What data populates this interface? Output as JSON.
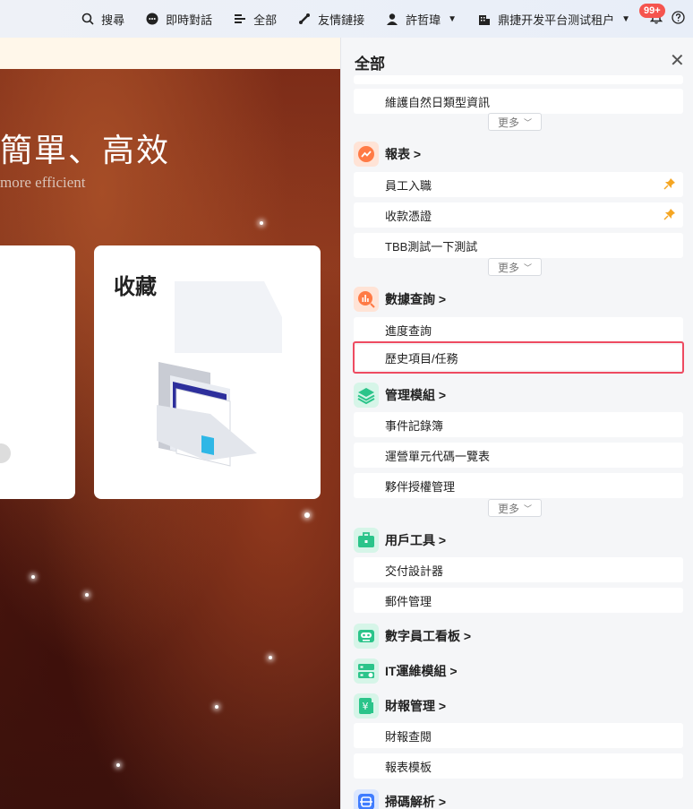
{
  "topbar": {
    "search_label": "搜尋",
    "chat_label": "即時對話",
    "all_label": "全部",
    "links_label": "友情鏈接",
    "user_label": "許哲瑋",
    "tenant_label": "鼎捷开发平台测试租户",
    "notification_count": "99+"
  },
  "hero": {
    "title": "簡單、高效",
    "subtitle": "more efficient",
    "fav_card_title": "收藏"
  },
  "panel": {
    "title": "全部",
    "more_label": "更多",
    "top_item": "維護自然日類型資訊",
    "groups": [
      {
        "label": "報表 >",
        "items": [
          "員工入職",
          "收款憑證",
          "TBB測試一下測試"
        ]
      },
      {
        "label": "數據查詢 >",
        "items": [
          "進度查詢",
          "歷史項目/任務"
        ]
      },
      {
        "label": "管理模組 >",
        "items": [
          "事件記錄簿",
          "運營單元代碼一覽表",
          "夥伴授權管理"
        ]
      },
      {
        "label": "用戶工具 >",
        "items": [
          "交付設計器",
          "郵件管理"
        ]
      },
      {
        "label": "數字員工看板 >",
        "items": []
      },
      {
        "label": "IT運維模組 >",
        "items": []
      },
      {
        "label": "財報管理 >",
        "items": [
          "財報查閱",
          "報表模板"
        ]
      },
      {
        "label": "掃碼解析 >",
        "items": []
      }
    ]
  },
  "colors": {
    "accent_orange": "#ff7a45",
    "accent_green": "#2bc48a",
    "highlight_red": "#ee4b61",
    "pin_orange": "#f5a623"
  }
}
